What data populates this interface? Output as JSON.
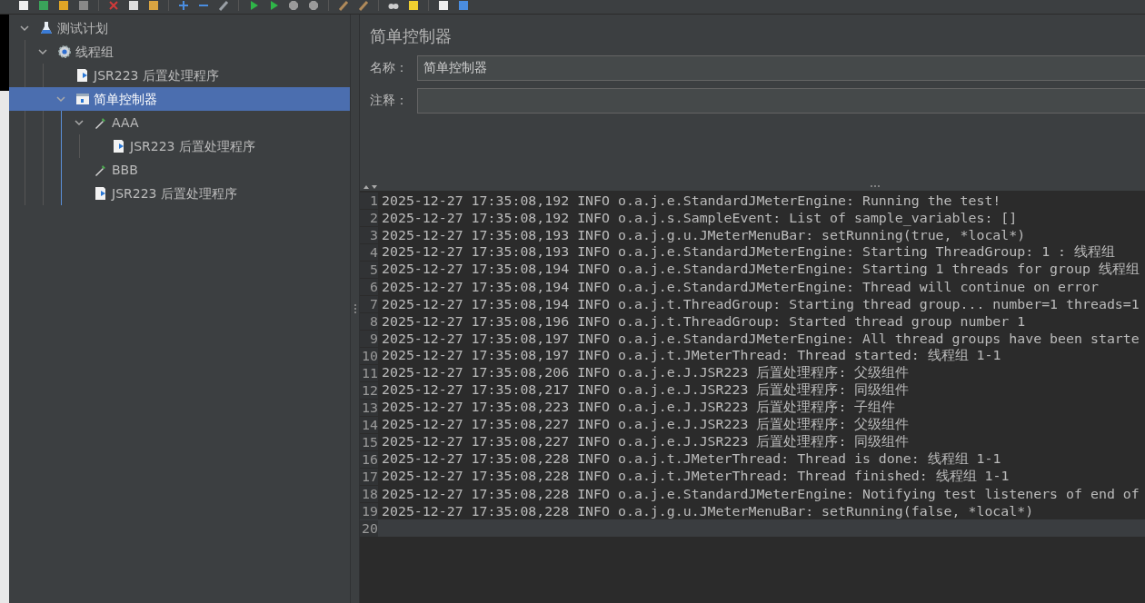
{
  "tree": [
    {
      "label": "测试计划",
      "kind": "test-plan",
      "expanded": true,
      "selected": false,
      "children": [
        {
          "label": "线程组",
          "kind": "thread-group",
          "expanded": true,
          "selected": false,
          "children": [
            {
              "label": "JSR223 后置处理程序",
              "kind": "script",
              "selected": false
            },
            {
              "label": "简单控制器",
              "kind": "controller",
              "expanded": true,
              "selected": true,
              "children": [
                {
                  "label": "AAA",
                  "kind": "sampler",
                  "expanded": true,
                  "selected": false,
                  "children": [
                    {
                      "label": "JSR223 后置处理程序",
                      "kind": "script",
                      "selected": false
                    }
                  ]
                },
                {
                  "label": "BBB",
                  "kind": "sampler",
                  "selected": false
                },
                {
                  "label": "JSR223 后置处理程序",
                  "kind": "script",
                  "selected": false
                }
              ]
            }
          ]
        }
      ]
    }
  ],
  "editor": {
    "title": "简单控制器",
    "fields": [
      {
        "label": "名称：",
        "value": "简单控制器"
      },
      {
        "label": "注释："
      }
    ]
  },
  "log": {
    "lines": [
      {
        "number": "1",
        "current": false,
        "text": "2025-12-27 17:35:08,192 INFO o.a.j.e.StandardJMeterEngine: Running the test!"
      },
      {
        "number": "2",
        "current": false,
        "text": "2025-12-27 17:35:08,192 INFO o.a.j.s.SampleEvent: List of sample_variables: []"
      },
      {
        "number": "3",
        "current": false,
        "text": "2025-12-27 17:35:08,193 INFO o.a.j.g.u.JMeterMenuBar: setRunning(true, *local*)"
      },
      {
        "number": "4",
        "current": false,
        "text": "2025-12-27 17:35:08,193 INFO o.a.j.e.StandardJMeterEngine: Starting ThreadGroup: 1 : 线程组"
      },
      {
        "number": "5",
        "current": false,
        "text": "2025-12-27 17:35:08,194 INFO o.a.j.e.StandardJMeterEngine: Starting 1 threads for group 线程组"
      },
      {
        "number": "6",
        "current": false,
        "text": "2025-12-27 17:35:08,194 INFO o.a.j.e.StandardJMeterEngine: Thread will continue on error"
      },
      {
        "number": "7",
        "current": false,
        "text": "2025-12-27 17:35:08,194 INFO o.a.j.t.ThreadGroup: Starting thread group... number=1 threads=1"
      },
      {
        "number": "8",
        "current": false,
        "text": "2025-12-27 17:35:08,196 INFO o.a.j.t.ThreadGroup: Started thread group number 1"
      },
      {
        "number": "9",
        "current": false,
        "text": "2025-12-27 17:35:08,197 INFO o.a.j.e.StandardJMeterEngine: All thread groups have been starte"
      },
      {
        "number": "10",
        "current": false,
        "text": "2025-12-27 17:35:08,197 INFO o.a.j.t.JMeterThread: Thread started: 线程组 1-1"
      },
      {
        "number": "11",
        "current": false,
        "text": "2025-12-27 17:35:08,206 INFO o.a.j.e.J.JSR223 后置处理程序: 父级组件"
      },
      {
        "number": "12",
        "current": false,
        "text": "2025-12-27 17:35:08,217 INFO o.a.j.e.J.JSR223 后置处理程序: 同级组件"
      },
      {
        "number": "13",
        "current": false,
        "text": "2025-12-27 17:35:08,223 INFO o.a.j.e.J.JSR223 后置处理程序: 子组件"
      },
      {
        "number": "14",
        "current": false,
        "text": "2025-12-27 17:35:08,227 INFO o.a.j.e.J.JSR223 后置处理程序: 父级组件"
      },
      {
        "number": "15",
        "current": false,
        "text": "2025-12-27 17:35:08,227 INFO o.a.j.e.J.JSR223 后置处理程序: 同级组件"
      },
      {
        "number": "16",
        "current": false,
        "text": "2025-12-27 17:35:08,228 INFO o.a.j.t.JMeterThread: Thread is done: 线程组 1-1"
      },
      {
        "number": "17",
        "current": false,
        "text": "2025-12-27 17:35:08,228 INFO o.a.j.t.JMeterThread: Thread finished: 线程组 1-1"
      },
      {
        "number": "18",
        "current": false,
        "text": "2025-12-27 17:35:08,228 INFO o.a.j.e.StandardJMeterEngine: Notifying test listeners of end of"
      },
      {
        "number": "19",
        "current": false,
        "text": "2025-12-27 17:35:08,228 INFO o.a.j.g.u.JMeterMenuBar: setRunning(false, *local*)"
      },
      {
        "number": "20",
        "current": true
      }
    ]
  }
}
